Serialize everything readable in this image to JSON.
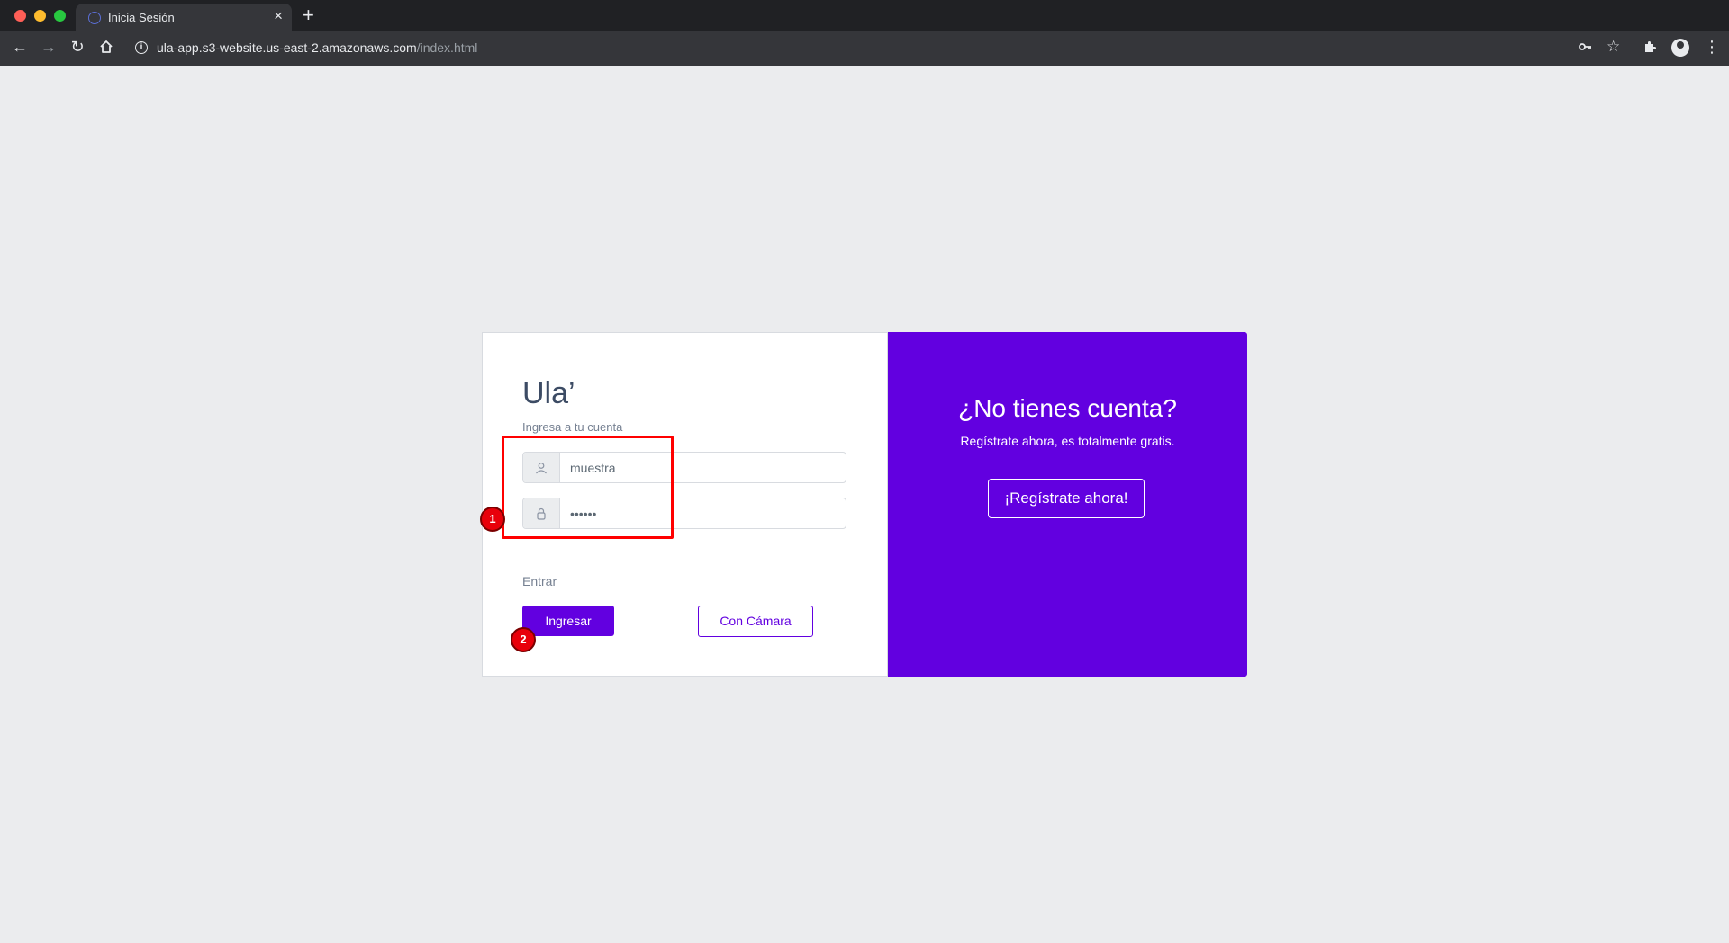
{
  "browser": {
    "tab_title": "Inicia Sesión",
    "tab_close": "×",
    "new_tab": "+",
    "url_host": "ula-app.s3-website.us-east-2.amazonaws.com",
    "url_path": "/index.html"
  },
  "login": {
    "brand": "Ula’",
    "subtitle": "Ingresa a tu cuenta",
    "username_value": "muestra",
    "password_value": "••••••",
    "section_label": "Entrar",
    "primary_button": "Ingresar",
    "camera_button": "Con Cámara"
  },
  "promo": {
    "title": "¿No tienes cuenta?",
    "text": "Regístrate ahora, es totalmente gratis.",
    "button": "¡Regístrate ahora!"
  },
  "annotations": {
    "badge_1": "1",
    "badge_2": "2"
  },
  "colors": {
    "accent": "#6200e0",
    "page_bg": "#ebecee",
    "annotation": "#ff0000"
  },
  "icons": [
    "back-arrow-icon",
    "forward-arrow-icon",
    "reload-icon",
    "home-icon",
    "info-icon",
    "key-icon",
    "star-icon",
    "puzzle-icon",
    "profile-icon",
    "kebab-menu-icon",
    "user-icon",
    "lock-icon"
  ]
}
